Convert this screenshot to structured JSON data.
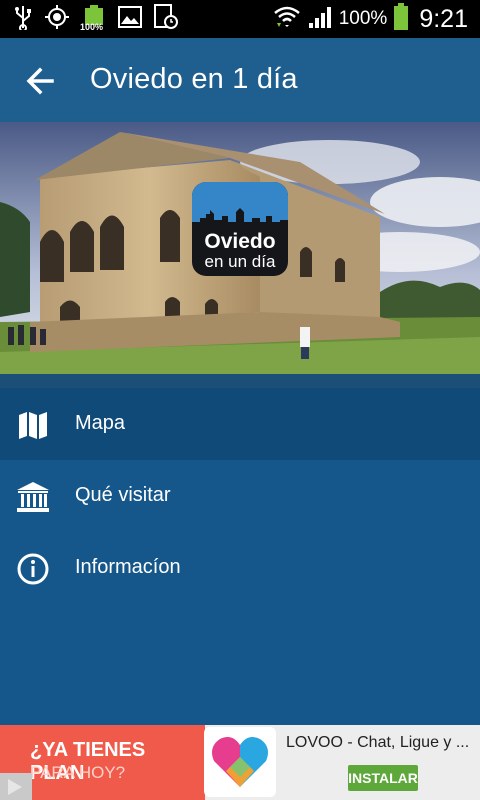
{
  "status_bar": {
    "icons": [
      "usb-icon",
      "gps-icon",
      "battery-small-icon",
      "image-icon",
      "clock-app-icon",
      "wifi-icon",
      "signal-icon",
      "battery-icon"
    ],
    "small_battery_label": "100%",
    "battery_text": "100%",
    "time": "9:21"
  },
  "app_bar": {
    "title": "Oviedo en 1 día",
    "back_icon": "arrow-back-icon"
  },
  "hero": {
    "logo_line1": "Oviedo",
    "logo_line2": "en un día"
  },
  "menu": {
    "items": [
      {
        "label": "Mapa",
        "icon": "map-icon",
        "active": true
      },
      {
        "label": "Qué visitar",
        "icon": "museum-icon",
        "active": false
      },
      {
        "label": "Informacíon",
        "icon": "info-icon",
        "active": false
      }
    ]
  },
  "ad": {
    "headline": "¿YA TIENES PLAN",
    "subline": "PARA HOY?",
    "app_name": "LOVOO - Chat, Ligue y ...",
    "install_label": "INSTALAR"
  },
  "colors": {
    "app_bar": "#1f5f8f",
    "background": "#15578a",
    "active_item": "#104a78",
    "ad_red": "#f05a4a",
    "install_green": "#5ea73b"
  }
}
